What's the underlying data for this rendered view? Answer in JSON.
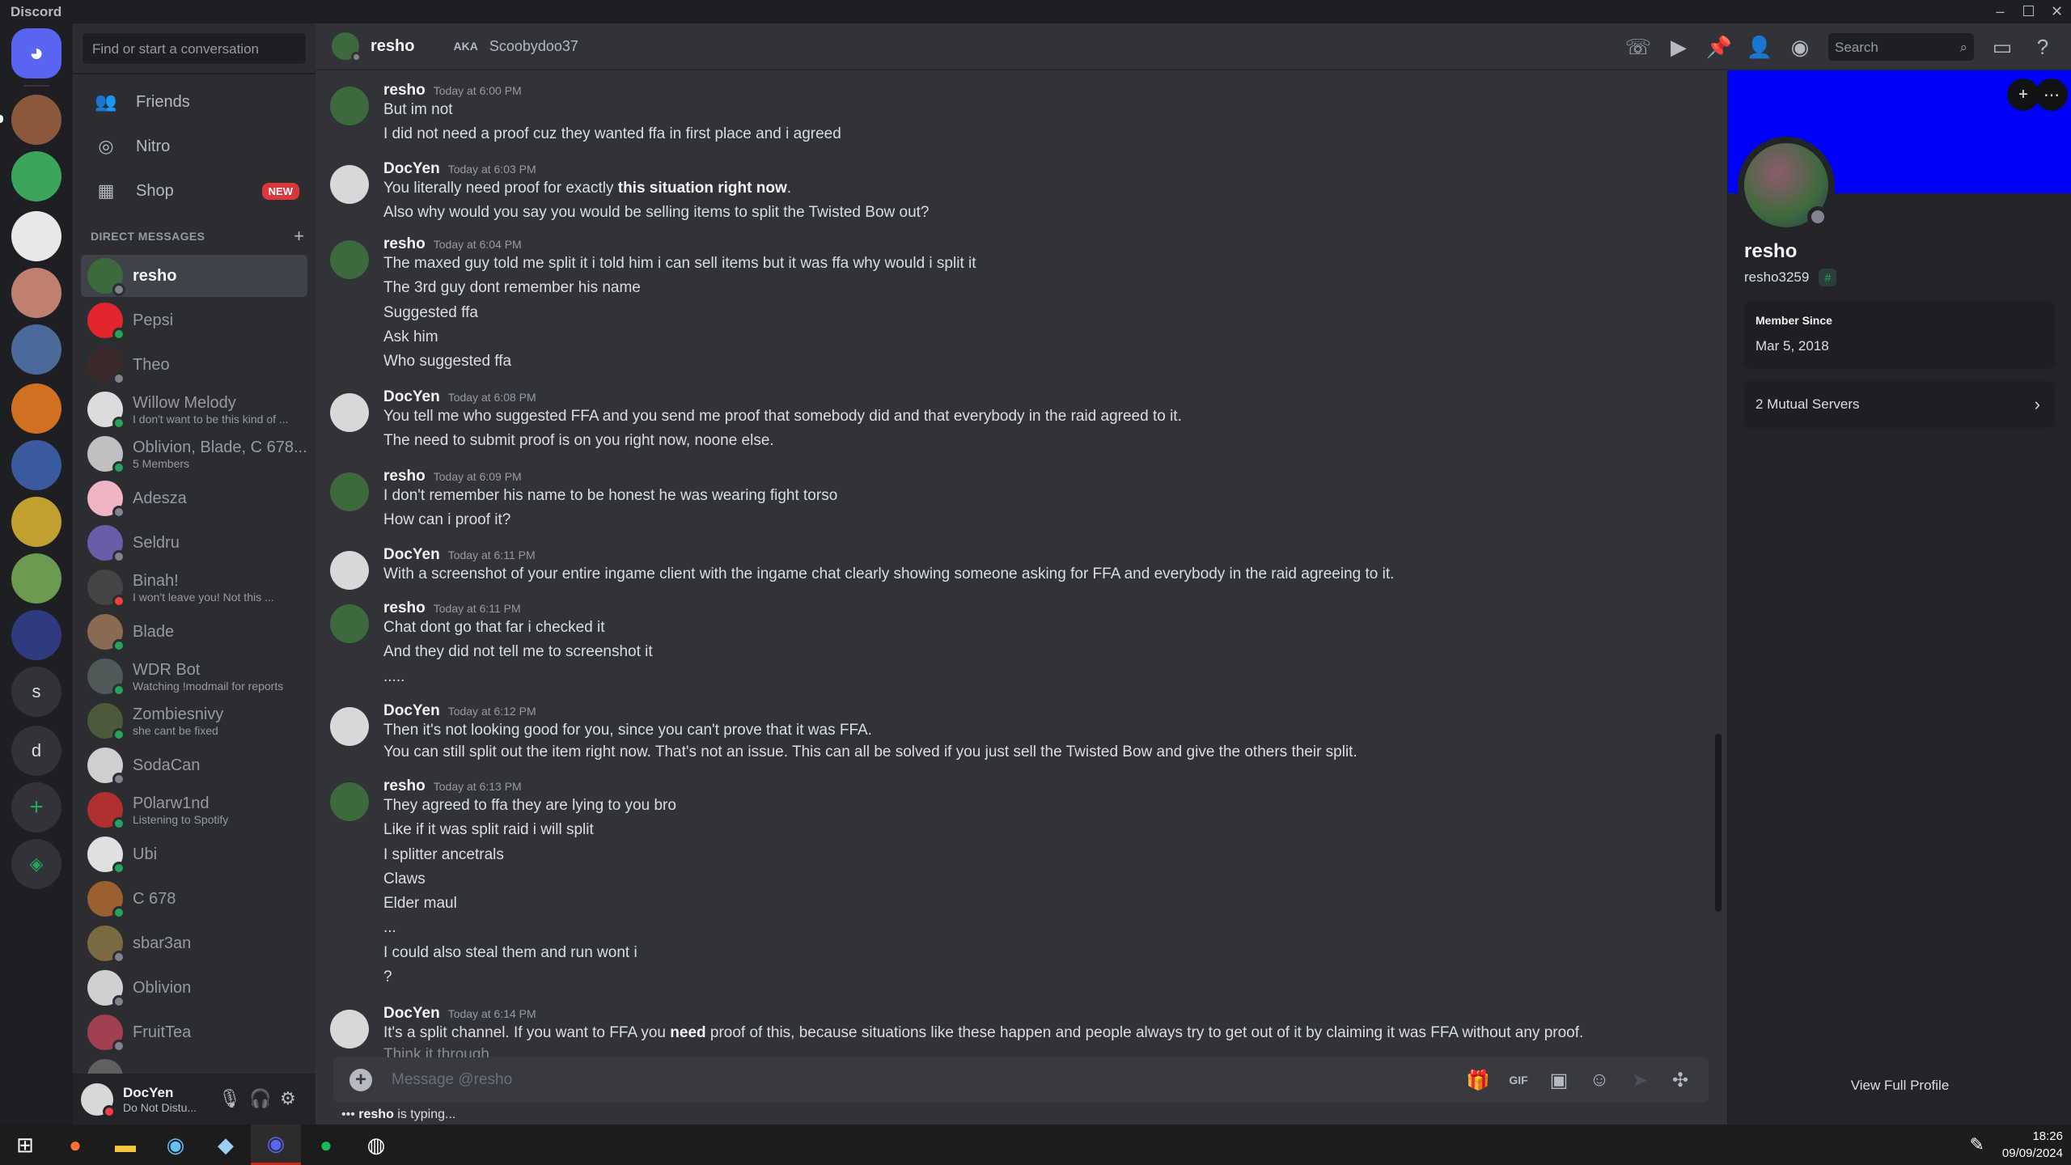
{
  "window": {
    "title": "Discord"
  },
  "colors": {
    "accent": "#5865f2",
    "banner": "#0000ff",
    "online": "#23a55a",
    "dnd": "#f23f43",
    "offline": "#80848e"
  },
  "sidebar": {
    "search_placeholder": "Find or start a conversation",
    "nav": [
      {
        "label": "Friends",
        "icon": "friends-icon"
      },
      {
        "label": "Nitro",
        "icon": "nitro-icon"
      },
      {
        "label": "Shop",
        "icon": "shop-icon",
        "badge": "NEW"
      }
    ],
    "dm_heading": "DIRECT MESSAGES",
    "dms": [
      {
        "name": "resho",
        "sub": "",
        "status": "off",
        "color": "#3c6a3c",
        "active": true
      },
      {
        "name": "Pepsi",
        "sub": "",
        "status": "on",
        "color": "#e3262e"
      },
      {
        "name": "Theo",
        "sub": "",
        "status": "off",
        "color": "#3a2a2a"
      },
      {
        "name": "Willow Melody",
        "sub": "I don't want to be this kind of ...",
        "status": "on",
        "color": "#dcdcdc"
      },
      {
        "name": "Oblivion, Blade, C 678...",
        "sub": "5 Members",
        "status": "on",
        "color": "#c0c0c0"
      },
      {
        "name": "Adesza",
        "sub": "",
        "status": "off",
        "color": "#f0b5c5"
      },
      {
        "name": "Seldru",
        "sub": "",
        "status": "off",
        "color": "#6a5ca8"
      },
      {
        "name": "Binah!",
        "sub": "I won't leave you! Not this ...",
        "status": "dnd",
        "color": "#444444"
      },
      {
        "name": "Blade",
        "sub": "",
        "status": "on",
        "color": "#8a6a50"
      },
      {
        "name": "WDR Bot",
        "sub": "Watching !modmail for reports",
        "status": "on",
        "color": "#505858"
      },
      {
        "name": "Zombiesnivy",
        "sub": "she cant be fixed",
        "status": "on",
        "color": "#4a5a3a"
      },
      {
        "name": "SodaCan",
        "sub": "",
        "status": "off",
        "color": "#cfcfcf"
      },
      {
        "name": "P0larw1nd",
        "sub": "Listening to Spotify",
        "status": "on",
        "color": "#b03030"
      },
      {
        "name": "Ubi",
        "sub": "",
        "status": "on",
        "color": "#e0e0e0"
      },
      {
        "name": "C 678",
        "sub": "",
        "status": "on",
        "color": "#9a6030"
      },
      {
        "name": "sbar3an",
        "sub": "",
        "status": "off",
        "color": "#7a6a40"
      },
      {
        "name": "Oblivion",
        "sub": "",
        "status": "off",
        "color": "#d0d0d0"
      },
      {
        "name": "FruitTea",
        "sub": "",
        "status": "off",
        "color": "#a04050"
      },
      {
        "name": "",
        "sub": "",
        "status": "off",
        "color": "#606060"
      }
    ],
    "user": {
      "name": "DocYen",
      "status": "Do Not Distu..."
    }
  },
  "servers": [
    {
      "icon": "discord-home-icon",
      "label": "",
      "color": "#5865f2"
    },
    {
      "icon": "server-icon",
      "label": "",
      "color": "#8a5a3a"
    },
    {
      "icon": "server-icon",
      "label": "",
      "color": "#3ca55c"
    },
    {
      "icon": "server-icon",
      "label": "",
      "color": "#e8e8e8"
    },
    {
      "icon": "server-icon",
      "label": "",
      "color": "#c08070"
    },
    {
      "icon": "server-icon",
      "label": "",
      "color": "#4a6a9a"
    },
    {
      "icon": "server-icon",
      "label": "",
      "color": "#d07020"
    },
    {
      "icon": "server-icon",
      "label": "",
      "color": "#3a5aa0"
    },
    {
      "icon": "server-icon",
      "label": "",
      "color": "#c0a030"
    },
    {
      "icon": "server-icon",
      "label": "",
      "color": "#6a9a50"
    },
    {
      "icon": "server-icon",
      "label": "",
      "color": "#303a80"
    },
    {
      "icon": "server-letter",
      "label": "s",
      "color": "#313338"
    },
    {
      "icon": "server-letter",
      "label": "d",
      "color": "#313338"
    },
    {
      "icon": "add-server-icon",
      "label": "+",
      "color": "#313338"
    },
    {
      "icon": "explore-icon",
      "label": "",
      "color": "#313338"
    }
  ],
  "header": {
    "name": "resho",
    "aka_label": "AKA",
    "aka": "Scoobydoo37",
    "search_placeholder": "Search"
  },
  "messages": [
    {
      "author": "resho",
      "time": "Today at 6:00 PM",
      "lines": [
        "But im not",
        "I did not need a proof cuz they wanted ffa in first place and i agreed"
      ]
    },
    {
      "author": "DocYen",
      "time": "Today at 6:03 PM",
      "lines": [
        "You literally need proof for exactly",
        "Also why would you say you would be selling items to split the Twisted Bow out?"
      ],
      "bold": "this situation right now"
    },
    {
      "author": "resho",
      "time": "Today at 6:04 PM",
      "lines": [
        "The maxed guy told me split it i told him i can sell items but it was ffa why would i split it",
        "The 3rd guy dont remember his name",
        "Suggested ffa",
        "Ask him",
        "Who suggested ffa"
      ]
    },
    {
      "author": "DocYen",
      "time": "Today at 6:08 PM",
      "lines": [
        "You tell me who suggested FFA and you send me proof that somebody did and that everybody in the raid agreed to it.",
        "The need to submit proof is on you right now, noone else."
      ]
    },
    {
      "author": "resho",
      "time": "Today at 6:09 PM",
      "lines": [
        "I don't remember his name to be honest he was wearing fight torso",
        "How can i proof it?"
      ]
    },
    {
      "author": "DocYen",
      "time": "Today at 6:11 PM",
      "lines": [
        "With a screenshot of your entire ingame client with the ingame chat clearly showing someone asking for FFA and everybody in the raid agreeing to it."
      ]
    },
    {
      "author": "resho",
      "time": "Today at 6:11 PM",
      "lines": [
        "Chat dont go that far i checked it",
        "And they did not tell me to screenshot it",
        "....."
      ]
    },
    {
      "author": "DocYen",
      "time": "Today at 6:12 PM",
      "lines": [
        "Then it's not looking good for you, since you can't prove that it was FFA.",
        "You can still split out the item right now. That's not an issue. This can all be solved if you just sell the Twisted Bow and give the others their split."
      ]
    },
    {
      "author": "resho",
      "time": "Today at 6:13 PM",
      "lines": [
        "They agreed to ffa they are lying to you bro",
        "Like if it was split raid i will split",
        "I splitter ancetrals",
        "Claws",
        "Elder maul",
        "...",
        "I could also steal them and run wont i",
        "?"
      ]
    },
    {
      "author": "DocYen",
      "time": "Today at 6:14 PM",
      "lines": [
        "It's a split channel. If you want to FFA you",
        "Think it through..."
      ],
      "bold2": "need",
      "rest2": "proof of this, because situations like these happen and people always try to get out of it by claiming it was FFA without any proof."
    }
  ],
  "composer": {
    "placeholder": "Message @resho",
    "typing_user": "resho",
    "typing_text": "is typing..."
  },
  "profile": {
    "name": "resho",
    "username": "resho3259",
    "member_since_label": "Member Since",
    "member_since": "Mar 5, 2018",
    "mutual": "2 Mutual Servers",
    "view_full": "View Full Profile"
  },
  "taskbar": {
    "time": "18:26",
    "date": "09/09/2024"
  }
}
